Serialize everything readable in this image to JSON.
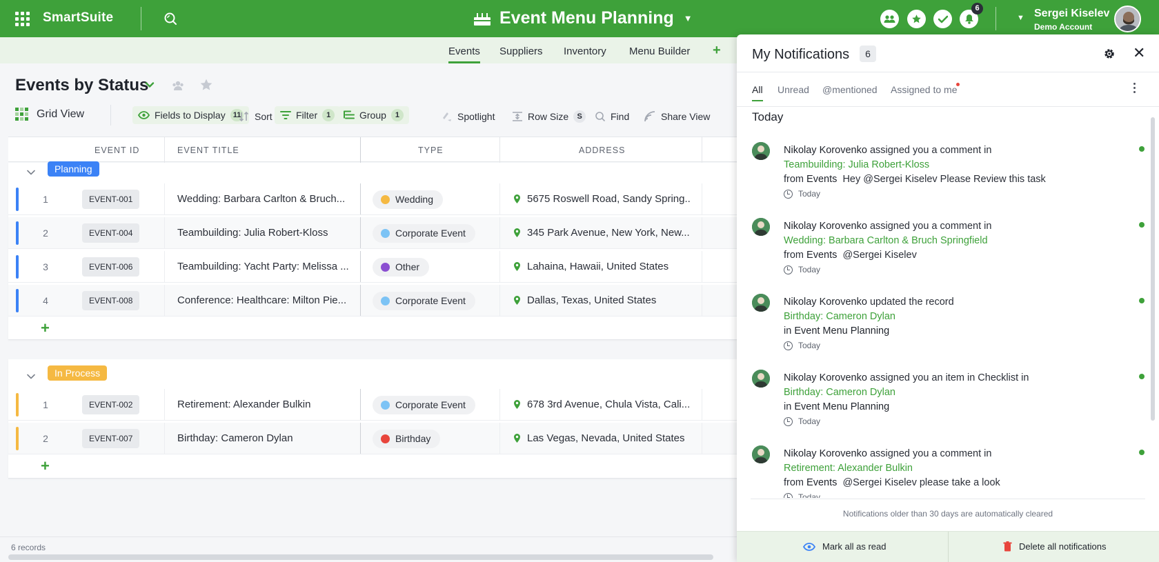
{
  "app": {
    "name": "SmartSuite"
  },
  "solution": {
    "title": "Event Menu Planning"
  },
  "notifications_badge": "6",
  "user": {
    "name": "Sergei Kiselev",
    "account": "Demo Account"
  },
  "tabs": [
    {
      "label": "Events",
      "active": true
    },
    {
      "label": "Suppliers"
    },
    {
      "label": "Inventory"
    },
    {
      "label": "Menu Builder"
    }
  ],
  "view": {
    "title": "Events by Status"
  },
  "toolbar": {
    "grid_view": "Grid View",
    "fields": "Fields to Display",
    "fields_count": "11",
    "sort": "Sort",
    "filter": "Filter",
    "filter_count": "1",
    "group": "Group",
    "group_count": "1",
    "spotlight": "Spotlight",
    "row_size": "Row Size",
    "row_size_value": "S",
    "find": "Find",
    "share": "Share View"
  },
  "columns": [
    "EVENT ID",
    "EVENT TITLE",
    "TYPE",
    "ADDRESS"
  ],
  "groups": [
    {
      "label": "Planning",
      "color": "#3b82f6",
      "rows": [
        {
          "num": "1",
          "id": "EVENT-001",
          "title": "Wedding: Barbara Carlton & Bruch...",
          "type": "Wedding",
          "type_color": "#f5b942",
          "address": "5675 Roswell Road, Sandy Spring..."
        },
        {
          "num": "2",
          "id": "EVENT-004",
          "title": "Teambuilding: Julia Robert-Kloss",
          "type": "Corporate Event",
          "type_color": "#7cc3f5",
          "address": "345 Park Avenue, New York, New..."
        },
        {
          "num": "3",
          "id": "EVENT-006",
          "title": "Teambuilding: Yacht Party: Melissa ...",
          "type": "Other",
          "type_color": "#8b4fd1",
          "address": "Lahaina, Hawaii, United States"
        },
        {
          "num": "4",
          "id": "EVENT-008",
          "title": "Conference: Healthcare: Milton Pie...",
          "type": "Corporate Event",
          "type_color": "#7cc3f5",
          "address": "Dallas, Texas, United States"
        }
      ]
    },
    {
      "label": "In Process",
      "color": "#f5b942",
      "rows": [
        {
          "num": "1",
          "id": "EVENT-002",
          "title": "Retirement: Alexander Bulkin",
          "type": "Corporate Event",
          "type_color": "#7cc3f5",
          "address": "678 3rd Avenue, Chula Vista, Cali..."
        },
        {
          "num": "2",
          "id": "EVENT-007",
          "title": "Birthday: Cameron Dylan",
          "type": "Birthday",
          "type_color": "#e8453c",
          "address": "Las Vegas, Nevada, United States"
        }
      ]
    }
  ],
  "footer": {
    "records": "6 records"
  },
  "panel": {
    "title": "My Notifications",
    "count": "6",
    "tabs": [
      "All",
      "Unread",
      "@mentioned",
      "Assigned to me"
    ],
    "section": "Today",
    "items": [
      {
        "actor": "Nikolay Korovenko",
        "action": "assigned you a comment in",
        "link": "Teambuilding: Julia Robert-Kloss",
        "prefix": "from",
        "where": "Events",
        "message": "Hey @Sergei Kiselev Please Review this task",
        "time": "Today"
      },
      {
        "actor": "Nikolay Korovenko",
        "action": "assigned you a comment in",
        "link": "Wedding: Barbara Carlton & Bruch Springfield",
        "prefix": "from",
        "where": "Events",
        "message": "@Sergei Kiselev",
        "time": "Today"
      },
      {
        "actor": "Nikolay Korovenko",
        "action": "updated the record",
        "link": "Birthday: Cameron Dylan",
        "prefix": "in",
        "where": "Event Menu Planning",
        "message": "",
        "time": "Today"
      },
      {
        "actor": "Nikolay Korovenko",
        "action": "assigned you an item in Checklist in",
        "link": "Birthday: Cameron Dylan",
        "prefix": "in",
        "where": "Event Menu Planning",
        "message": "",
        "time": "Today"
      },
      {
        "actor": "Nikolay Korovenko",
        "action": "assigned you a comment in",
        "link": "Retirement: Alexander Bulkin",
        "prefix": "from",
        "where": "Events",
        "message": "@Sergei Kiselev please take a look",
        "time": "Today"
      }
    ],
    "older_note": "Notifications older than 30 days are automatically cleared",
    "mark_all": "Mark all as read",
    "delete_all": "Delete all notifications"
  }
}
